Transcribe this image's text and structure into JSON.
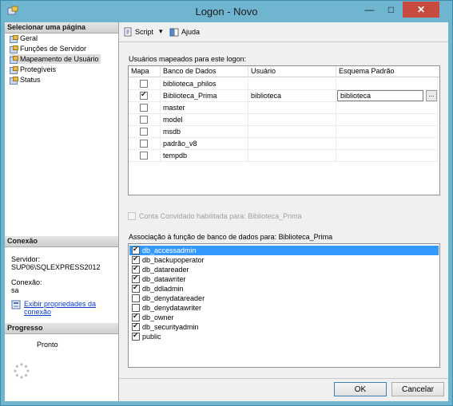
{
  "window": {
    "title": "Logon - Novo"
  },
  "sidebar": {
    "pages_header": "Selecionar uma página",
    "items": [
      {
        "label": "Geral"
      },
      {
        "label": "Funções de Servidor"
      },
      {
        "label": "Mapeamento de Usuário"
      },
      {
        "label": "Protegíveis"
      },
      {
        "label": "Status"
      }
    ],
    "selected_item": "Mapeamento de Usuário",
    "connection_header": "Conexão",
    "server_label": "Servidor:",
    "server_value": "SUP06\\SQLEXPRESS2012",
    "connection_label": "Conexão:",
    "connection_value": "sa",
    "view_props_line1": "Exibir propriedades da",
    "view_props_line2": "conexão",
    "progress_header": "Progresso",
    "progress_status": "Pronto"
  },
  "toolbar": {
    "script_label": "Script",
    "help_label": "Ajuda"
  },
  "mapping": {
    "caption": "Usuários mapeados para este logon:",
    "columns": [
      "Mapa",
      "Banco de Dados",
      "Usuário",
      "Esquema Padrão"
    ],
    "rows": [
      {
        "mapped": false,
        "database": "biblioteca_philos",
        "user": "",
        "schema": ""
      },
      {
        "mapped": true,
        "database": "Biblioteca_Prima",
        "user": "biblioteca",
        "schema": "biblioteca"
      },
      {
        "mapped": false,
        "database": "master",
        "user": "",
        "schema": ""
      },
      {
        "mapped": false,
        "database": "model",
        "user": "",
        "schema": ""
      },
      {
        "mapped": false,
        "database": "msdb",
        "user": "",
        "schema": ""
      },
      {
        "mapped": false,
        "database": "padrão_v8",
        "user": "",
        "schema": ""
      },
      {
        "mapped": false,
        "database": "tempdb",
        "user": "",
        "schema": ""
      }
    ],
    "ellipsis_label": "..."
  },
  "guest": {
    "label": "Conta Convidado habilitada para: Biblioteca_Prima",
    "enabled": false
  },
  "roles": {
    "caption": "Associação à função de banco de dados para: Biblioteca_Prima",
    "items": [
      {
        "name": "db_accessadmin",
        "checked": true
      },
      {
        "name": "db_backupoperator",
        "checked": true
      },
      {
        "name": "db_datareader",
        "checked": true
      },
      {
        "name": "db_datawriter",
        "checked": true
      },
      {
        "name": "db_ddladmin",
        "checked": true
      },
      {
        "name": "db_denydatareader",
        "checked": false
      },
      {
        "name": "db_denydatawriter",
        "checked": false
      },
      {
        "name": "db_owner",
        "checked": true
      },
      {
        "name": "db_securityadmin",
        "checked": true
      },
      {
        "name": "public",
        "checked": true
      }
    ],
    "highlighted": "db_accessadmin"
  },
  "buttons": {
    "ok": "OK",
    "cancel": "Cancelar"
  },
  "colors": {
    "highlight": "#3399ff",
    "title_bar": "#6fb5cf",
    "close": "#c74a3f"
  }
}
